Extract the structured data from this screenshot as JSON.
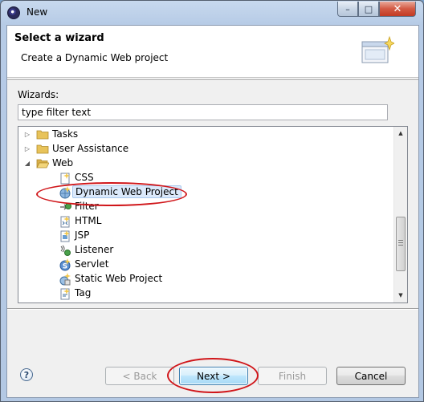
{
  "window": {
    "title": "New",
    "controls": {
      "minimize": "–",
      "maximize": "□",
      "close": "✕"
    }
  },
  "banner": {
    "title": "Select a wizard",
    "description": "Create a Dynamic Web project"
  },
  "wizards_label": "Wizards:",
  "filter": {
    "value": "type filter text"
  },
  "tree": {
    "folders": [
      {
        "label": "Tasks",
        "expanded": false
      },
      {
        "label": "User Assistance",
        "expanded": false
      },
      {
        "label": "Web",
        "expanded": true
      }
    ],
    "web_items": [
      {
        "label": "CSS",
        "icon": "css-file-icon",
        "partial": true
      },
      {
        "label": "Dynamic Web Project",
        "icon": "web-project-icon",
        "selected": true
      },
      {
        "label": "Filter",
        "icon": "filter-icon",
        "partial": true
      },
      {
        "label": "HTML",
        "icon": "html-file-icon"
      },
      {
        "label": "JSP",
        "icon": "jsp-file-icon"
      },
      {
        "label": "Listener",
        "icon": "listener-icon"
      },
      {
        "label": "Servlet",
        "icon": "servlet-icon"
      },
      {
        "label": "Static Web Project",
        "icon": "static-web-project-icon"
      },
      {
        "label": "Tag",
        "icon": "tag-file-icon"
      }
    ]
  },
  "buttons": {
    "help": "?",
    "back": "< Back",
    "next": "Next >",
    "finish": "Finish",
    "cancel": "Cancel"
  },
  "colors": {
    "annotation": "#d0161a",
    "folder": "#e8c35a",
    "selection": "#dbe9fb"
  }
}
